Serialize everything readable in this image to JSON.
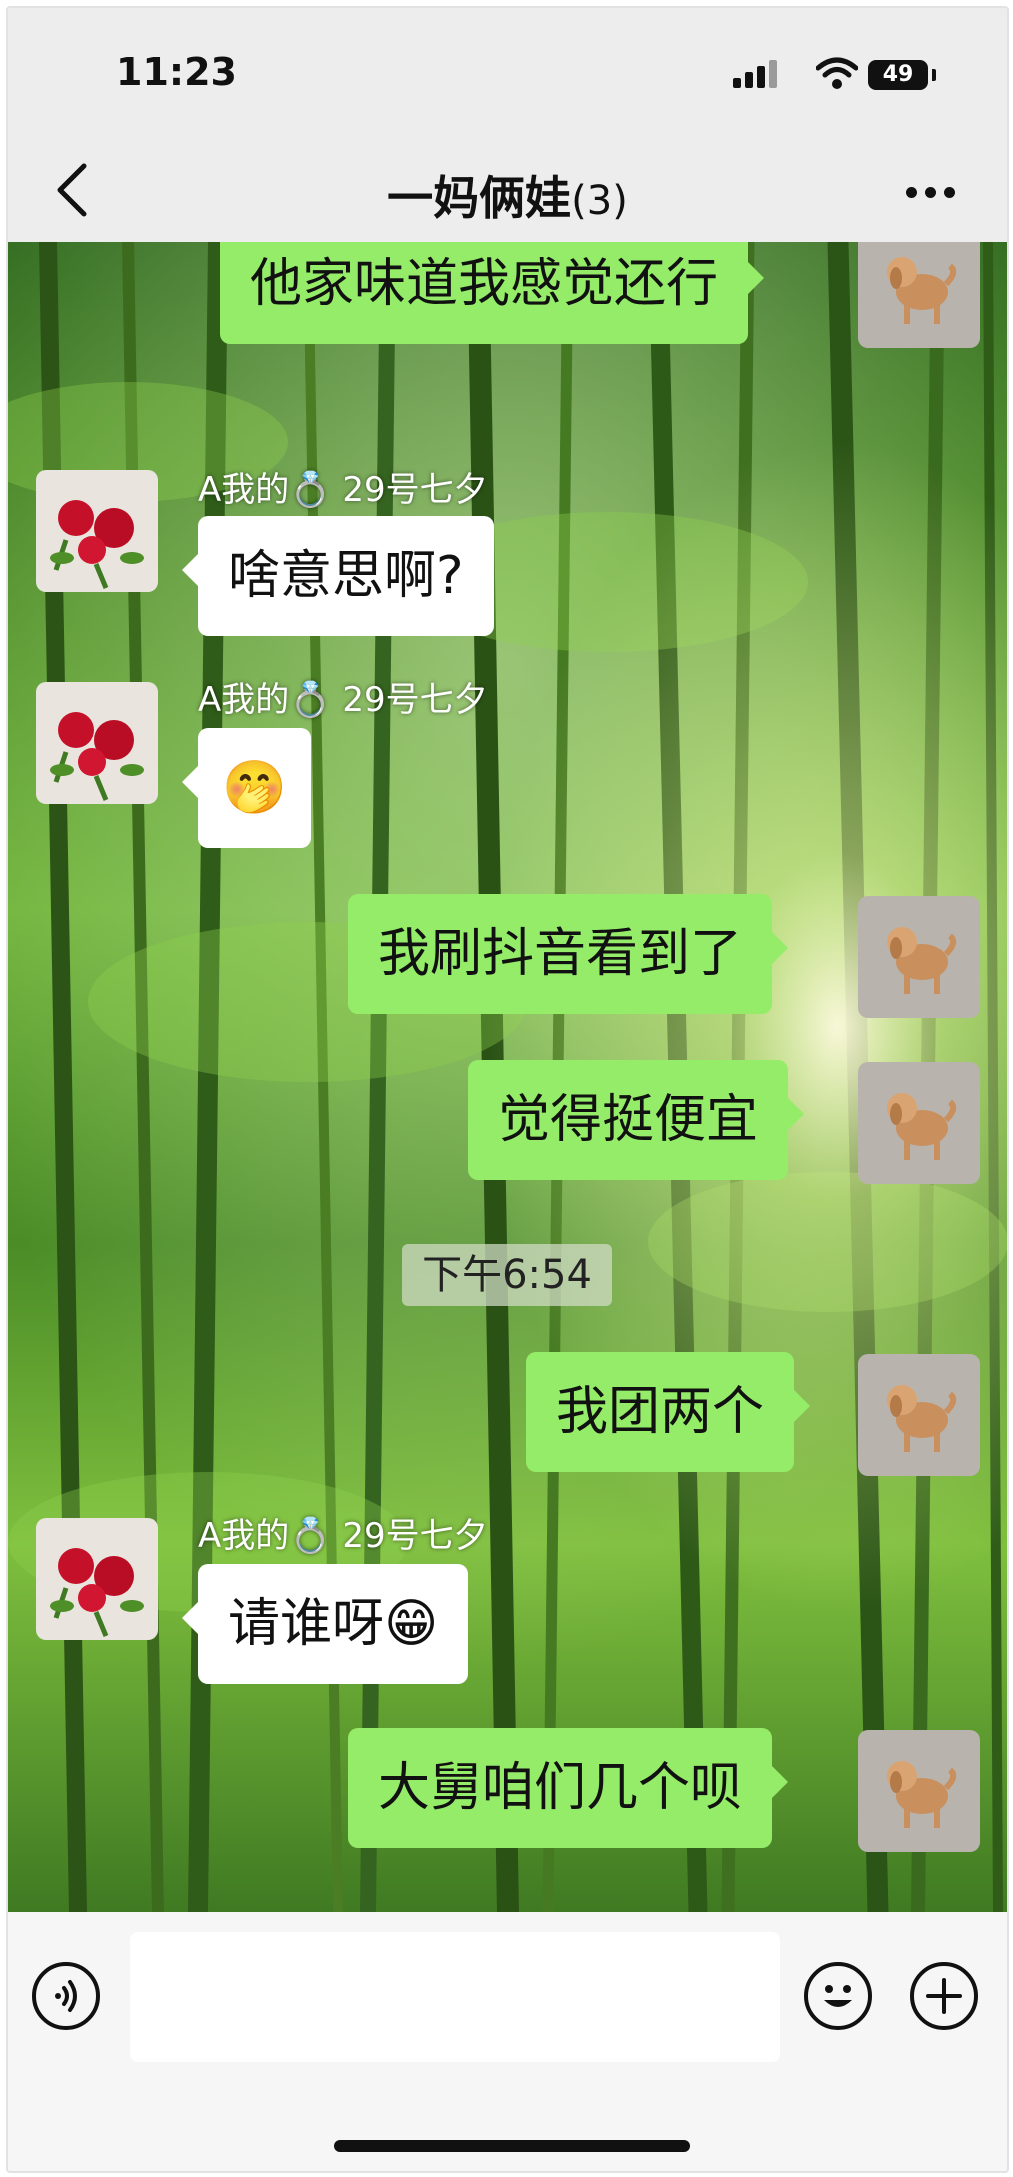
{
  "status_bar": {
    "time": "11:23",
    "battery": "49"
  },
  "header": {
    "title": "一妈俩娃",
    "count": "(3)"
  },
  "chat": {
    "timestamp": "下午6:54",
    "sender_name": "A我的💍  29号七夕",
    "messages": [
      {
        "side": "me",
        "text": "他家味道我感觉还行"
      },
      {
        "side": "them",
        "text": "啥意思啊?"
      },
      {
        "side": "them",
        "text": "🤭"
      },
      {
        "side": "me",
        "text": "我刷抖音看到了"
      },
      {
        "side": "me",
        "text": "觉得挺便宜"
      },
      {
        "side": "me",
        "text": "我团两个"
      },
      {
        "side": "them",
        "text": "请谁呀😁"
      },
      {
        "side": "me",
        "text": "大舅咱们几个呗"
      }
    ]
  },
  "colors": {
    "my_bubble": "#95ec69",
    "their_bubble": "#ffffff",
    "bar_background": "#ededed"
  },
  "icons": [
    "back-icon",
    "more-icon",
    "voice-icon",
    "emoji-icon",
    "plus-icon"
  ]
}
